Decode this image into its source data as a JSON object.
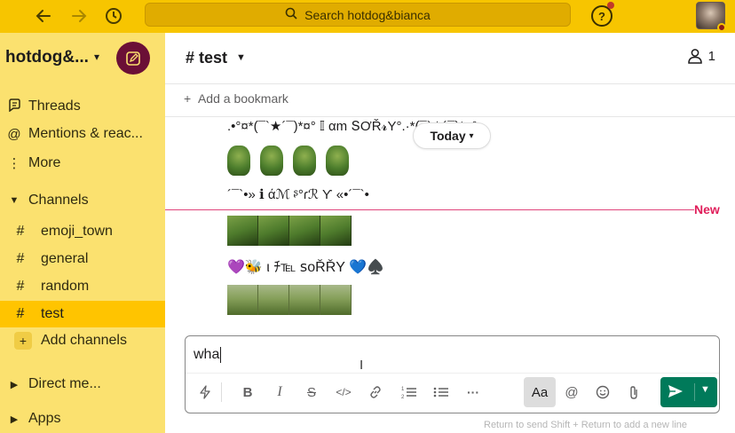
{
  "topbar": {
    "search_placeholder": "Search hotdog&bianca",
    "back_icon": "arrow-left-icon",
    "forward_icon": "arrow-right-icon",
    "history_icon": "clock-icon",
    "help_icon": "help-circle-icon"
  },
  "sidebar": {
    "workspace_name": "hotdog&...",
    "nav": [
      {
        "label": "Threads",
        "icon": "threads-icon"
      },
      {
        "label": "Mentions & reac...",
        "icon": "at-icon"
      },
      {
        "label": "More",
        "icon": "more-vertical-icon"
      }
    ],
    "channels_header": "Channels",
    "channels": [
      {
        "name": "emoji_town"
      },
      {
        "name": "general"
      },
      {
        "name": "random"
      },
      {
        "name": "test",
        "active": true
      }
    ],
    "add_channels": "Add channels",
    "direct_messages": "Direct me...",
    "apps": "Apps"
  },
  "channel": {
    "title": "# test",
    "member_count": "1",
    "bookmark": "Add a bookmark",
    "today": "Today",
    "new_label": "New"
  },
  "messages": {
    "line1": ".•°¤*(¯`★´¯)*¤° 𝕀 αm ՏƠŘ𝓻Y°.·*(¯`★´¯)*¤°•.",
    "line2": "´¯`•» ℹ άℳ ᶳ°ɾℛ Ƴ «•´¯`•",
    "line3_prefix": "💜🐝",
    "line3_text": " ι ﾁ℡ ꜱᴏŘŘY ",
    "line3_suffix": "💙♠️"
  },
  "composer": {
    "text": "wha",
    "aa_label": "Aa",
    "hint": "Return to send   Shift + Return to add a new line"
  },
  "colors": {
    "topbar": "#f7c500",
    "sidebar": "#fbe16f",
    "active_channel": "#ffc400",
    "compose_button": "#6b0f36",
    "new_line": "#e01e5a",
    "send_button": "#007a5a"
  }
}
